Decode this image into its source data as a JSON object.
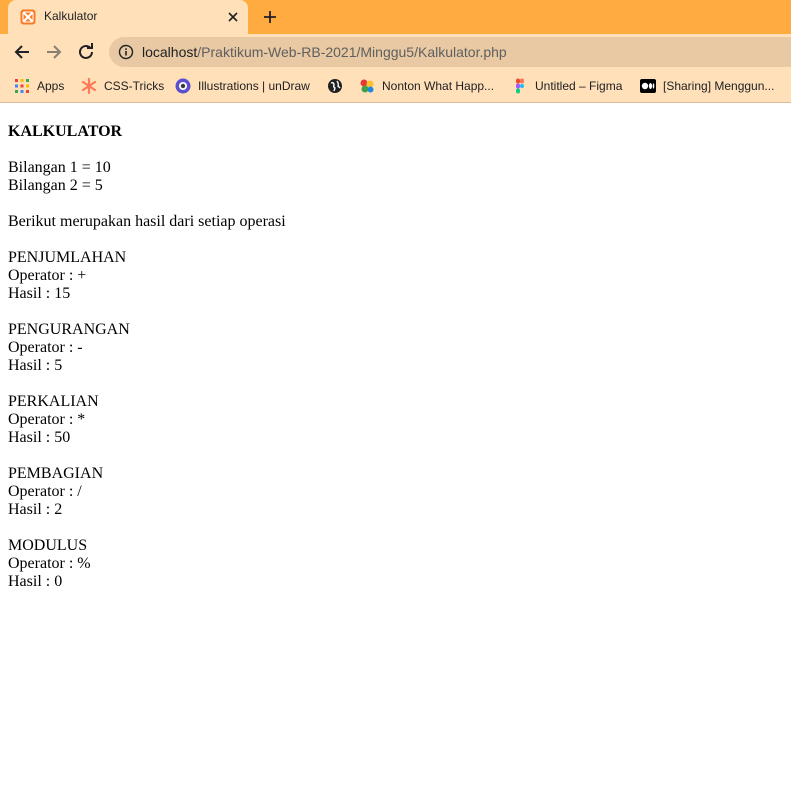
{
  "browser": {
    "tab_title": "Kalkulator",
    "url_host": "localhost",
    "url_path": "/Praktikum-Web-RB-2021/Minggu5/Kalkulator.php",
    "accent_color": "#ffab40",
    "toolbar_color": "#ffe0b8"
  },
  "bookmarks": [
    {
      "label": "Apps",
      "icon": "apps-grid-icon"
    },
    {
      "label": "CSS-Tricks",
      "icon": "css-tricks-icon"
    },
    {
      "label": "Illustrations | unDraw",
      "icon": "undraw-icon"
    },
    {
      "label": "",
      "icon": "globe-icon"
    },
    {
      "label": "Nonton What Happ...",
      "icon": "nonton-icon"
    },
    {
      "label": "Untitled – Figma",
      "icon": "figma-icon"
    },
    {
      "label": "[Sharing] Menggun...",
      "icon": "medium-icon"
    }
  ],
  "page": {
    "heading": "KALKULATOR",
    "bilangan1": "Bilangan 1 = 10",
    "bilangan2": "Bilangan 2 = 5",
    "intro": "Berikut merupakan hasil dari setiap operasi",
    "operations": [
      {
        "name": "PENJUMLAHAN",
        "operator": "Operator : +",
        "result": "Hasil : 15"
      },
      {
        "name": "PENGURANGAN",
        "operator": "Operator : -",
        "result": "Hasil : 5"
      },
      {
        "name": "PERKALIAN",
        "operator": "Operator : *",
        "result": "Hasil : 50"
      },
      {
        "name": "PEMBAGIAN",
        "operator": "Operator : /",
        "result": "Hasil : 2"
      },
      {
        "name": "MODULUS",
        "operator": "Operator : %",
        "result": "Hasil : 0"
      }
    ]
  }
}
